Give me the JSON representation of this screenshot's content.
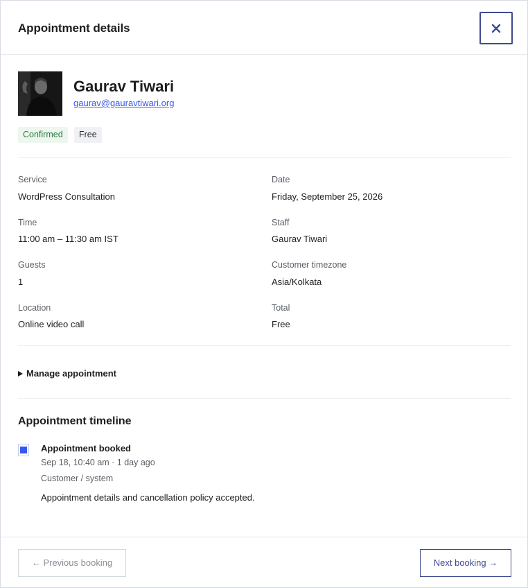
{
  "header": {
    "title": "Appointment details",
    "close_icon": "close-icon"
  },
  "profile": {
    "name": "Gaurav Tiwari",
    "email": "gaurav@gauravtiwari.org",
    "avatar_icon": "avatar"
  },
  "badges": {
    "status": "Confirmed",
    "price": "Free"
  },
  "details": {
    "service_label": "Service",
    "service_value": "WordPress Consultation",
    "date_label": "Date",
    "date_value": "Friday, September 25, 2026",
    "time_label": "Time",
    "time_value": "11:00 am – 11:30 am IST",
    "staff_label": "Staff",
    "staff_value": "Gaurav Tiwari",
    "guests_label": "Guests",
    "guests_value": "1",
    "timezone_label": "Customer timezone",
    "timezone_value": "Asia/Kolkata",
    "location_label": "Location",
    "location_value": "Online video call",
    "total_label": "Total",
    "total_value": "Free"
  },
  "manage": {
    "label": "Manage appointment"
  },
  "timeline": {
    "title": "Appointment timeline",
    "events": [
      {
        "title": "Appointment booked",
        "time": "Sep 18, 10:40 am · 1 day ago",
        "actor": "Customer / system",
        "description": "Appointment details and cancellation policy accepted."
      }
    ]
  },
  "footer": {
    "prev_label": "← Previous booking",
    "next_label": "Next booking →"
  },
  "colors": {
    "accent": "#3858e9",
    "button_border": "#3e4a8f",
    "confirmed_bg": "#edf7ef",
    "confirmed_text": "#2b7a3f"
  }
}
